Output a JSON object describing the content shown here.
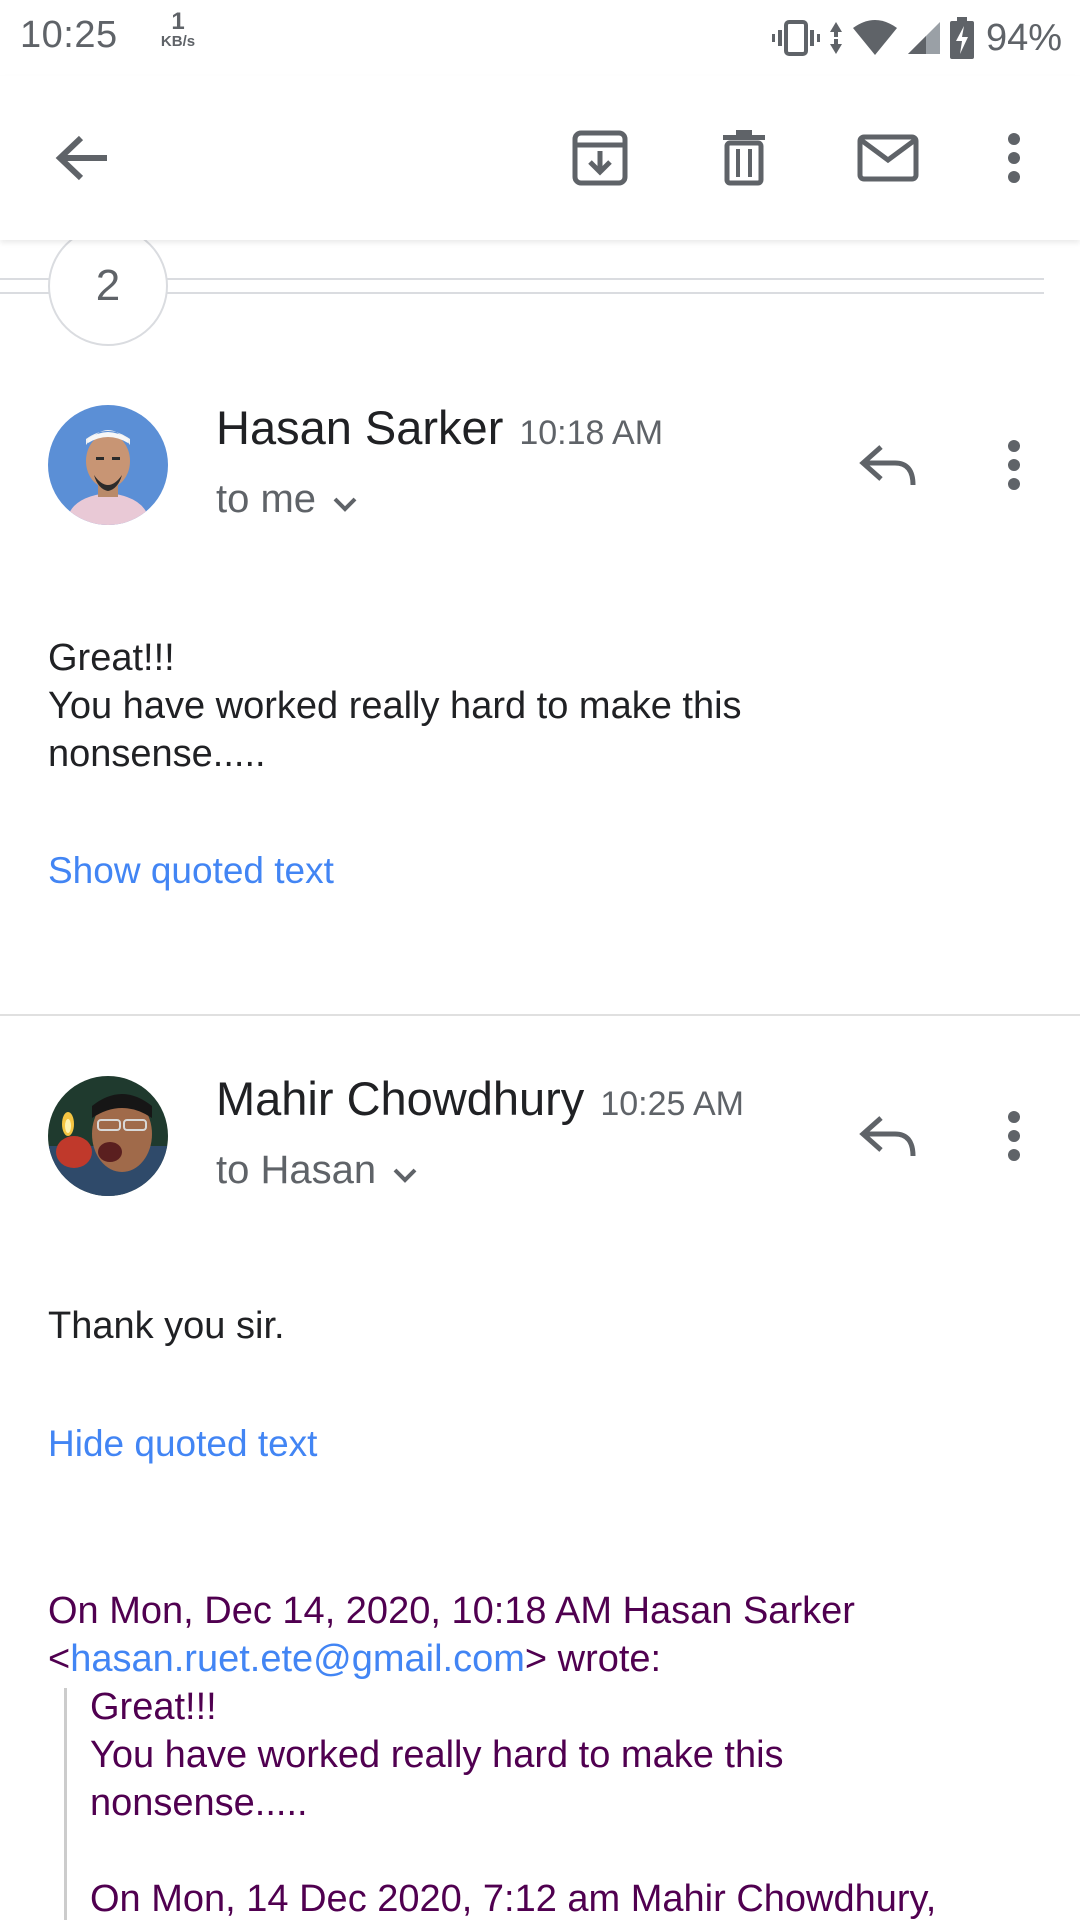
{
  "status_bar": {
    "time": "10:25",
    "net_speed_value": "1",
    "net_speed_unit": "KB/s",
    "battery_percent": "94%",
    "icons": [
      "vibrate-icon",
      "data-arrows-icon",
      "wifi-icon",
      "cell-signal-icon",
      "battery-charging-icon"
    ]
  },
  "app_bar": {
    "icons": [
      "back-arrow-icon",
      "archive-icon",
      "delete-icon",
      "mark-unread-icon",
      "more-vert-icon"
    ]
  },
  "thread": {
    "collapsed_count": "2",
    "messages": [
      {
        "sender": "Hasan Sarker",
        "time": "10:18 AM",
        "recipient": "to me",
        "body_lines": [
          "Great!!!",
          "You have worked really hard to make this",
          "nonsense....."
        ],
        "quote_toggle": "Show quoted text"
      },
      {
        "sender": "Mahir Chowdhury",
        "time": "10:25 AM",
        "recipient": "to Hasan",
        "body_lines": [
          "Thank you sir."
        ],
        "quote_toggle": "Hide quoted text",
        "quoted": {
          "header_line1": "On Mon, Dec 14, 2020, 10:18 AM Hasan Sarker",
          "header_open": "<",
          "header_email": "hasan.ruet.ete@gmail.com",
          "header_close": "> wrote:",
          "lines": [
            "Great!!!",
            "You have worked really hard to make this",
            "nonsense....."
          ],
          "nested_header": "On Mon, 14 Dec 2020, 7:12 am Mahir Chowdhury,"
        }
      }
    ]
  },
  "colors": {
    "link": "#4285f4",
    "quoted_text": "#500050",
    "secondary_text": "#5f6368",
    "primary_text": "#202124"
  }
}
